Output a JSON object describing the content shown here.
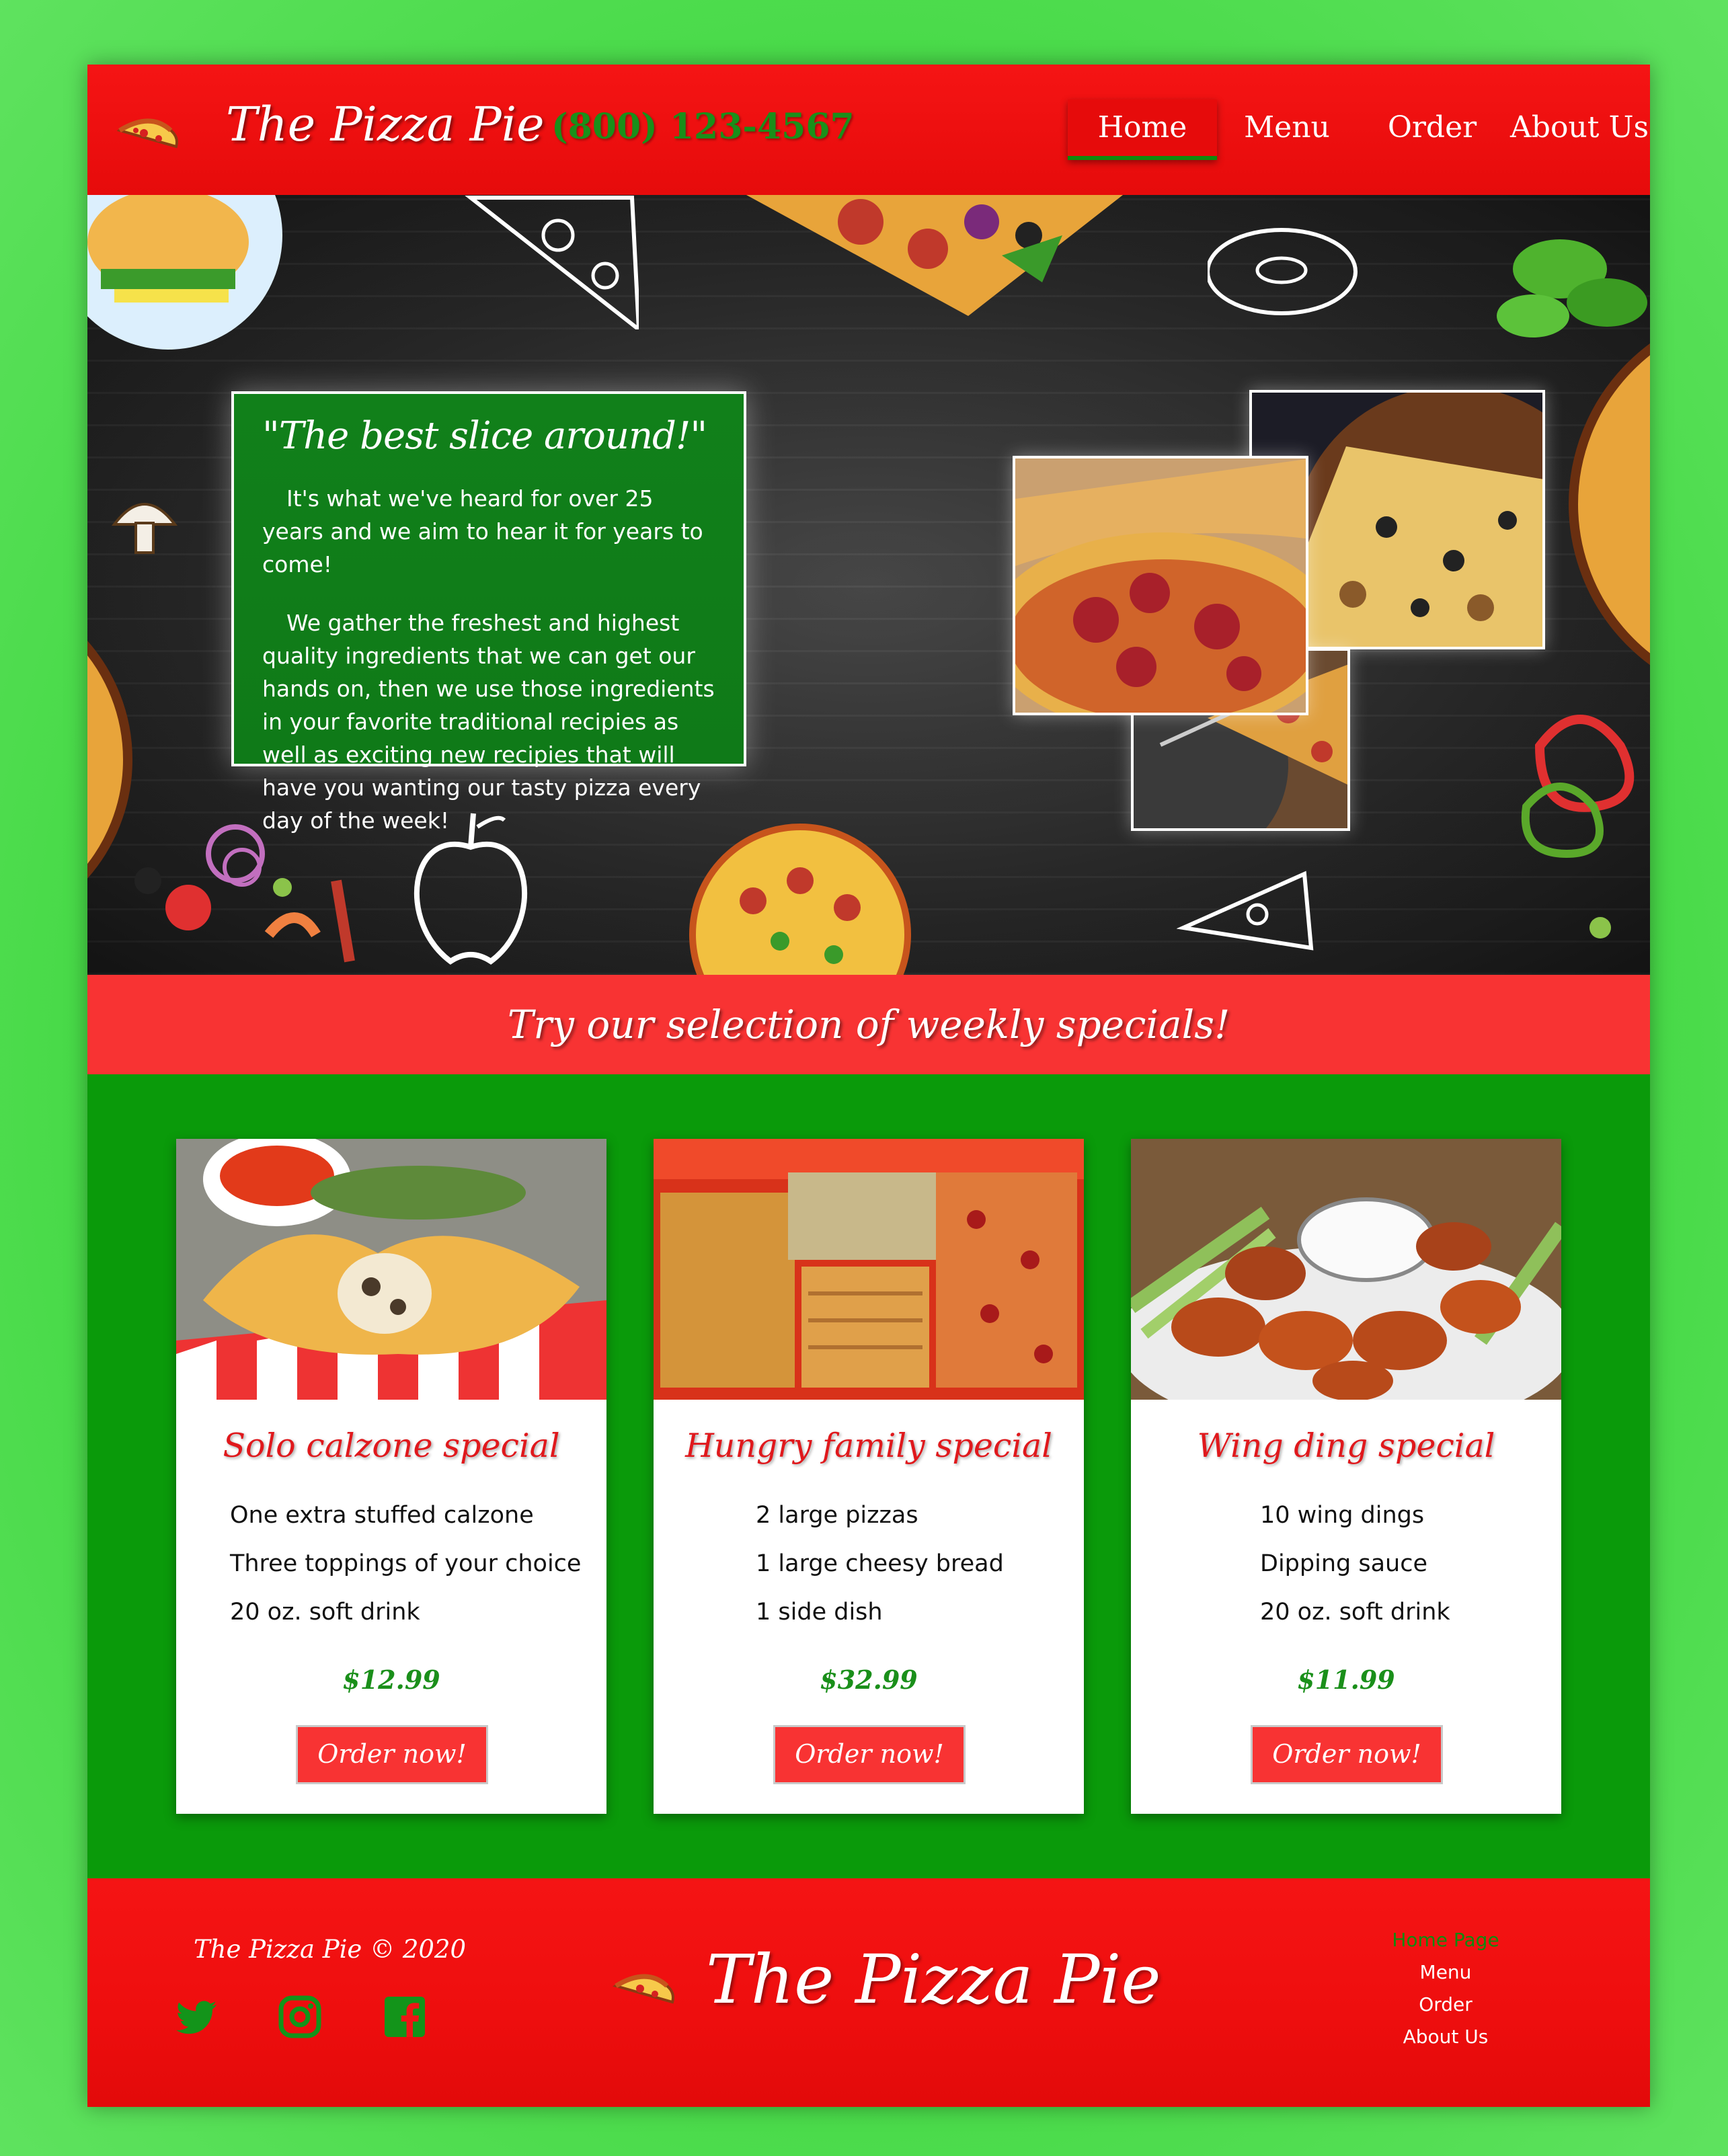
{
  "header": {
    "brand": "The Pizza Pie",
    "phone": "(800) 123-4567",
    "nav": [
      {
        "label": "Home",
        "active": true
      },
      {
        "label": "Menu"
      },
      {
        "label": "Order"
      },
      {
        "label": "About Us"
      }
    ]
  },
  "hero": {
    "quote_title": "\"The best slice around!\"",
    "paragraph_1": "It's what we've heard for over 25 years and we aim to hear it for years to come!",
    "paragraph_2": "We gather the freshest and highest quality ingredients that we can get our hands on, then we use those ingredients in your favorite traditional recipies as well as exciting new recipies that will have you wanting our tasty pizza every day of the week!"
  },
  "banner": {
    "text": "Try our selection of weekly specials!"
  },
  "specials": [
    {
      "title": "Solo calzone special",
      "items": [
        "One extra stuffed calzone",
        "Three toppings of your choice",
        "20 oz. soft drink"
      ],
      "price": "$12.99",
      "button": "Order now!"
    },
    {
      "title": "Hungry family special",
      "items": [
        "2 large pizzas",
        "1 large cheesy bread",
        "1 side dish"
      ],
      "price": "$32.99",
      "button": "Order now!"
    },
    {
      "title": "Wing ding special",
      "items": [
        "10 wing dings",
        "Dipping sauce",
        "20 oz. soft drink"
      ],
      "price": "$11.99",
      "button": "Order now!"
    }
  ],
  "footer": {
    "copyright": "The Pizza Pie © 2020",
    "brand": "The Pizza Pie",
    "links": [
      "Home Page",
      "Menu",
      "Order",
      "About Us"
    ],
    "social_icons": [
      "twitter-icon",
      "instagram-icon",
      "facebook-icon"
    ]
  },
  "colors": {
    "brand_red": "#f51414",
    "brand_green": "#0a9a0a",
    "page_green": "#45d945",
    "price_green": "#1a8f1a"
  }
}
